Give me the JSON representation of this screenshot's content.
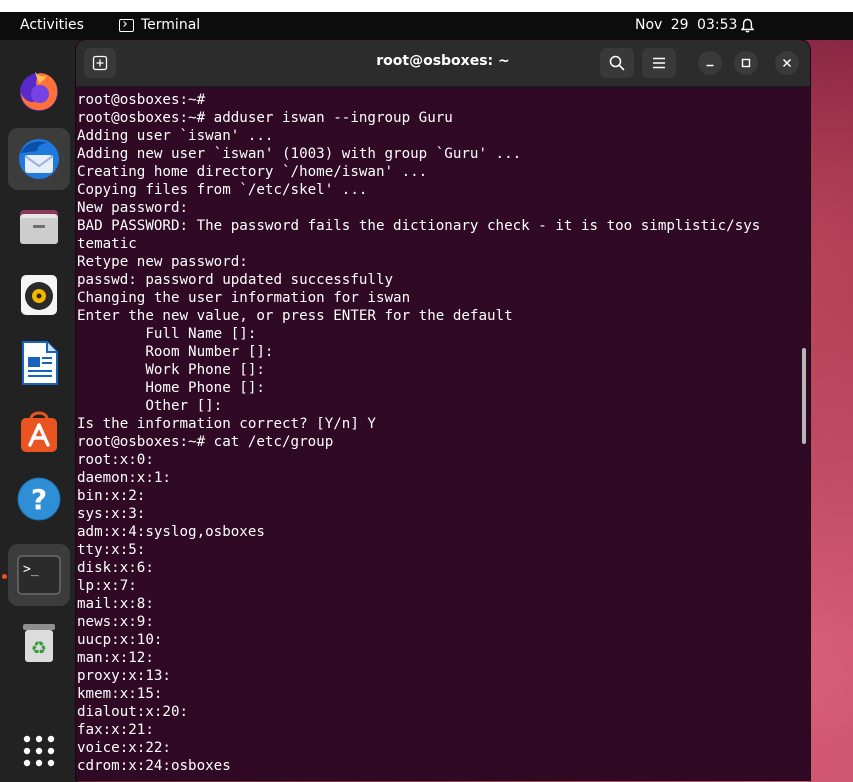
{
  "topbar": {
    "activities": "Activities",
    "app_name": "Terminal",
    "date": "Nov 29",
    "time": "03:53",
    "status_icon": "alarm-clock-icon"
  },
  "dock": {
    "items": [
      {
        "icon": "firefox-icon"
      },
      {
        "icon": "thunderbird-icon"
      },
      {
        "icon": "files-icon"
      },
      {
        "icon": "rhythmbox-icon"
      },
      {
        "icon": "libreoffice-writer-icon"
      },
      {
        "icon": "ubuntu-software-icon"
      },
      {
        "icon": "help-icon",
        "glyph": "?"
      },
      {
        "icon": "terminal-icon",
        "glyph": ">_",
        "active": true
      },
      {
        "icon": "trash-icon",
        "glyph": "♻"
      },
      {
        "icon": "show-apps-icon"
      }
    ]
  },
  "window": {
    "title": "root@osboxes: ~",
    "buttons": [
      "new-tab-icon",
      "search-icon",
      "hamburger-menu-icon",
      "minimize-icon",
      "maximize-icon",
      "close-icon"
    ]
  },
  "terminal": {
    "lines": [
      "root@osboxes:~#",
      "root@osboxes:~# adduser iswan --ingroup Guru",
      "Adding user `iswan' ...",
      "Adding new user `iswan' (1003) with group `Guru' ...",
      "Creating home directory `/home/iswan' ...",
      "Copying files from `/etc/skel' ...",
      "New password:",
      "BAD PASSWORD: The password fails the dictionary check - it is too simplistic/sys",
      "tematic",
      "Retype new password:",
      "passwd: password updated successfully",
      "Changing the user information for iswan",
      "Enter the new value, or press ENTER for the default",
      "        Full Name []:",
      "        Room Number []:",
      "        Work Phone []:",
      "        Home Phone []:",
      "        Other []:",
      "Is the information correct? [Y/n] Y",
      "root@osboxes:~# cat /etc/group",
      "root:x:0:",
      "daemon:x:1:",
      "bin:x:2:",
      "sys:x:3:",
      "adm:x:4:syslog,osboxes",
      "tty:x:5:",
      "disk:x:6:",
      "lp:x:7:",
      "mail:x:8:",
      "news:x:9:",
      "uucp:x:10:",
      "man:x:12:",
      "proxy:x:13:",
      "kmem:x:15:",
      "dialout:x:20:",
      "fax:x:21:",
      "voice:x:22:",
      "cdrom:x:24:osboxes"
    ]
  },
  "colors": {
    "terminal_bg": "#300a24",
    "terminal_fg": "#ffffff",
    "headerbar": "#2c2c2c",
    "topbar": "#0c0c0c",
    "dock": "#222222",
    "accent": "#e95420"
  }
}
